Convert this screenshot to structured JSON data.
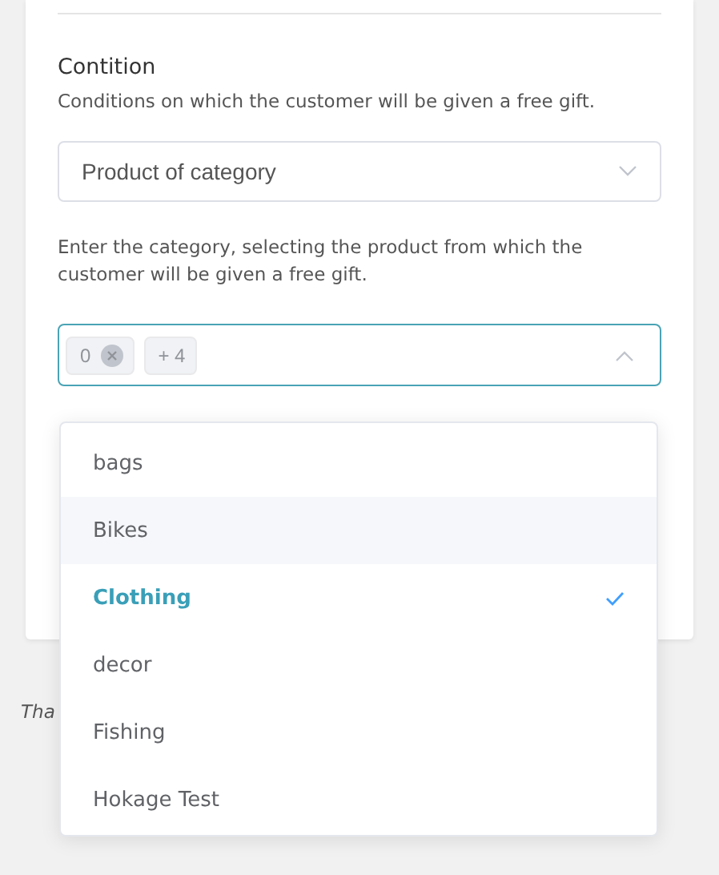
{
  "section": {
    "title": "Contition",
    "description": "Conditions on which the customer will be given a free gift."
  },
  "condition_select": {
    "value": "Product of category",
    "expanded": false
  },
  "category_help": "Enter the category, selecting the product from which the customer will be given a free gift.",
  "category_select": {
    "expanded": true,
    "tags": [
      {
        "label": "0",
        "removable": true
      },
      {
        "label": "+ 4",
        "removable": false
      }
    ]
  },
  "dropdown_options": [
    {
      "label": "bags",
      "highlighted": false,
      "selected": false
    },
    {
      "label": "Bikes",
      "highlighted": true,
      "selected": false
    },
    {
      "label": "Clothing",
      "highlighted": false,
      "selected": true
    },
    {
      "label": "decor",
      "highlighted": false,
      "selected": false
    },
    {
      "label": "Fishing",
      "highlighted": false,
      "selected": false
    },
    {
      "label": "Hokage Test",
      "highlighted": false,
      "selected": false
    }
  ],
  "footer_text": "Tha"
}
